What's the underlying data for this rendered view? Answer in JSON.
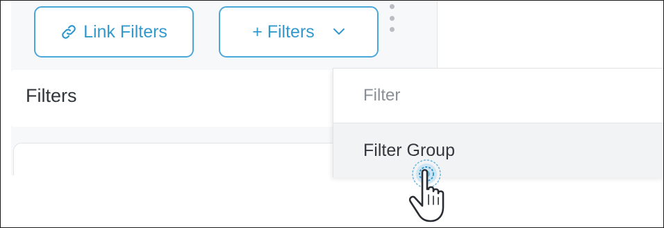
{
  "toolbar": {
    "link_filters_label": "Link Filters",
    "add_filters_label": "+ Filters",
    "link_icon": "link-icon",
    "dropdown_icon": "chevron-down-icon",
    "more_icon": "kebab-icon"
  },
  "panel": {
    "title": "Filters"
  },
  "dropdown_menu": {
    "items": [
      {
        "label": "Filter",
        "highlighted": false
      },
      {
        "label": "Filter Group",
        "highlighted": true
      }
    ]
  },
  "cursor": {
    "icon": "hand-pointer-icon"
  },
  "colors": {
    "accent": "#3399cc",
    "button_border": "#4aa8d8",
    "panel_bg": "#f7f8fa",
    "menu_hover_bg": "#f2f3f5",
    "text_primary": "#30353b",
    "text_muted": "#8a8f96"
  }
}
